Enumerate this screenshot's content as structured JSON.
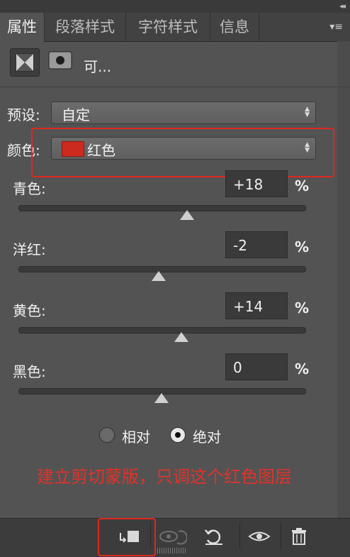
{
  "panel": {
    "collapse_glyph": "◂◂",
    "tabs": [
      {
        "label": "属性",
        "active": true
      },
      {
        "label": "段落样式",
        "active": false
      },
      {
        "label": "字符样式",
        "active": false
      },
      {
        "label": "信息",
        "active": false
      }
    ],
    "menu_glyph": "▾≡"
  },
  "header": {
    "adjustment_icon": "adjustment-icon",
    "mask_icon": "mask-icon",
    "title": "可..."
  },
  "preset": {
    "label": "预设:",
    "value": "自定"
  },
  "color_select": {
    "label": "颜色:",
    "value": "红色",
    "swatch_color": "#cc2a1e"
  },
  "sliders": [
    {
      "label": "青色:",
      "value": "+18",
      "unit": "%",
      "fraction": 0.59
    },
    {
      "label": "洋红:",
      "value": "-2",
      "unit": "%",
      "fraction": 0.49
    },
    {
      "label": "黄色:",
      "value": "+14",
      "unit": "%",
      "fraction": 0.57
    },
    {
      "label": "黑色:",
      "value": "0",
      "unit": "%",
      "fraction": 0.5
    }
  ],
  "method": {
    "options": [
      {
        "label": "相对",
        "selected": false
      },
      {
        "label": "绝对",
        "selected": true
      }
    ]
  },
  "annotation": {
    "text": "建立剪切蒙版，只调这个红色图层",
    "color": "#e2322a"
  },
  "toolbar": {
    "buttons": [
      {
        "name": "clip-to-layer-icon",
        "glyph": "↲■"
      },
      {
        "name": "view-previous-icon",
        "glyph": "◉"
      },
      {
        "name": "reset-icon",
        "glyph": "↺"
      },
      {
        "name": "visibility-icon",
        "glyph": "👁"
      },
      {
        "name": "trash-icon",
        "glyph": "🗑"
      }
    ]
  }
}
